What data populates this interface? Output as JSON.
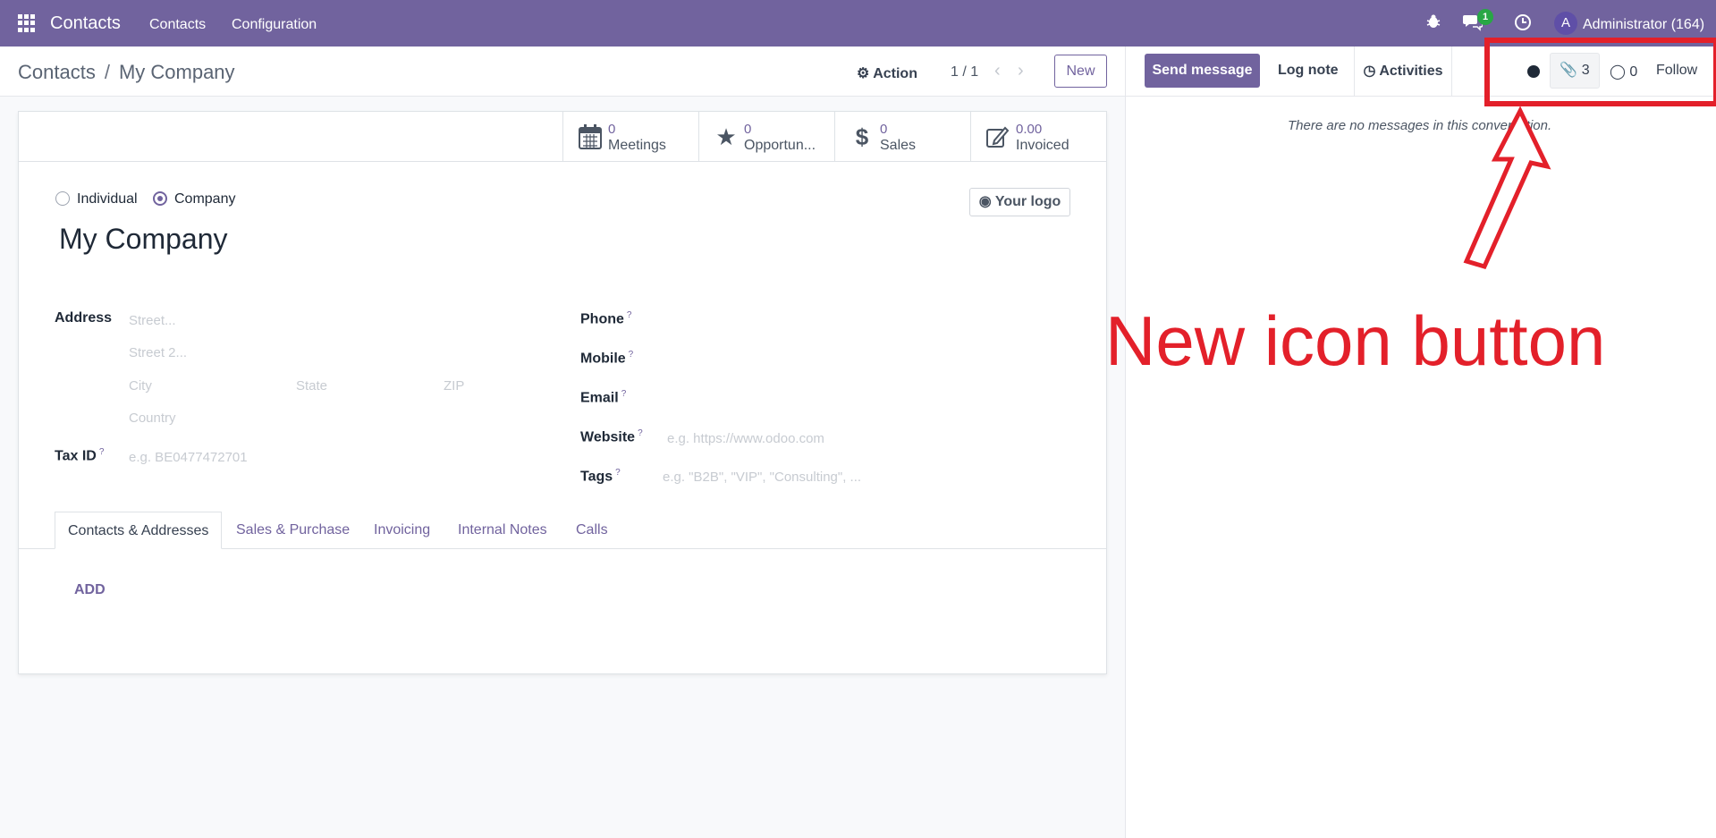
{
  "navbar": {
    "brand": "Contacts",
    "menus": [
      "Contacts",
      "Configuration"
    ],
    "messages_badge": "1",
    "avatar_initial": "A",
    "user": "Administrator (164)"
  },
  "control_panel": {
    "breadcrumb_parent": "Contacts",
    "breadcrumb_separator": "/",
    "breadcrumb_current": "My Company",
    "action_label": "Action",
    "pager": "1 / 1",
    "new_label": "New"
  },
  "stat_buttons": [
    {
      "value": "0",
      "label": "Meetings",
      "icon": "calendar-icon"
    },
    {
      "value": "0",
      "label": "Opportun...",
      "icon": "star-icon"
    },
    {
      "value": "0",
      "label": "Sales",
      "icon": "dollar-icon"
    },
    {
      "value": "0.00",
      "label": "Invoiced",
      "icon": "edit-icon"
    }
  ],
  "form": {
    "type_individual": "Individual",
    "type_company": "Company",
    "selected_type": "Company",
    "name": "My Company",
    "logo_label": "Your logo",
    "address_label": "Address",
    "street_placeholder": "Street...",
    "street2_placeholder": "Street 2...",
    "city_placeholder": "City",
    "state_placeholder": "State",
    "zip_placeholder": "ZIP",
    "country_placeholder": "Country",
    "tax_id_label": "Tax ID",
    "tax_id_placeholder": "e.g. BE0477472701",
    "phone_label": "Phone",
    "mobile_label": "Mobile",
    "email_label": "Email",
    "website_label": "Website",
    "website_placeholder": "e.g. https://www.odoo.com",
    "tags_label": "Tags",
    "tags_placeholder": "e.g. \"B2B\", \"VIP\", \"Consulting\", ...",
    "help_mark": "?"
  },
  "tabs": [
    "Contacts & Addresses",
    "Sales & Purchase",
    "Invoicing",
    "Internal Notes",
    "Calls"
  ],
  "add_label": "ADD",
  "chatter": {
    "send_message": "Send message",
    "log_note": "Log note",
    "activities": "Activities",
    "attachments_count": "3",
    "followers_count": "0",
    "follow": "Follow",
    "empty": "There are no messages in this conversation."
  },
  "annotation": {
    "text": "New icon button",
    "color": "#e3202a"
  },
  "colors": {
    "brand": "#71639e",
    "accent_green": "#28a745"
  }
}
